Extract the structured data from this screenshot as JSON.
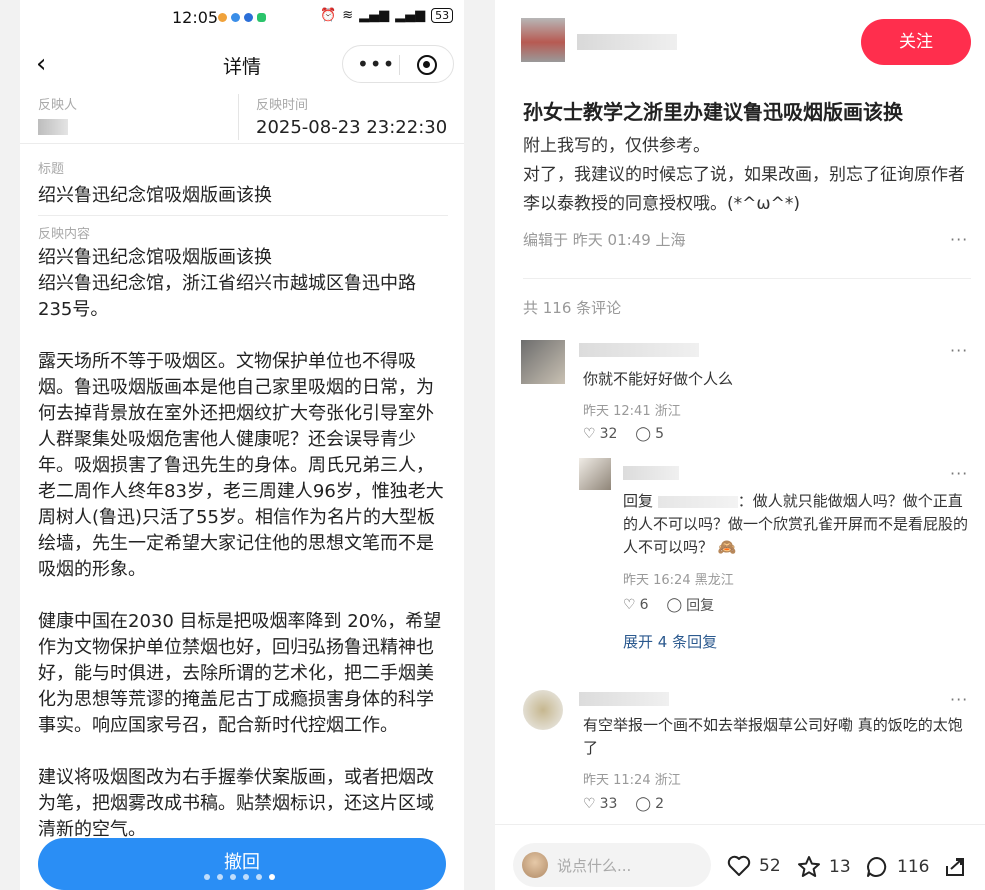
{
  "left": {
    "status": {
      "time": "12:05",
      "battery": "53"
    },
    "nav": {
      "title": "详情"
    },
    "reporter_label": "反映人",
    "report_time_label": "反映时间",
    "report_time": "2025-08-23 23:22:30",
    "title_label": "标题",
    "title_value": "绍兴鲁迅纪念馆吸烟版画该换",
    "content_label": "反映内容",
    "content_head": "绍兴鲁迅纪念馆吸烟版画该换",
    "content_address": "绍兴鲁迅纪念馆，浙江省绍兴市越城区鲁迅中路235号。",
    "para1": "露天场所不等于吸烟区。文物保护单位也不得吸烟。鲁迅吸烟版画本是他自己家里吸烟的日常，为何去掉背景放在室外还把烟纹扩大夸张化引导室外人群聚集处吸烟危害他人健康呢？还会误导青少年。吸烟损害了鲁迅先生的身体。周氏兄弟三人，老二周作人终年83岁，老三周建人96岁，惟独老大周树人(鲁迅)只活了55岁。相信作为名片的大型板绘墙，先生一定希望大家记住他的思想文笔而不是吸烟的形象。",
    "para2": "健康中国在2030 目标是把吸烟率降到 20%，希望作为文物保护单位禁烟也好，回归弘扬鲁迅精神也好，能与时俱进，去除所谓的艺术化，把二手烟美化为思想等荒谬的掩盖尼古丁成瘾损害身体的科学事实。响应国家号召，配合新时代控烟工作。",
    "para3": "建议将吸烟图改为右手握拳伏案版画，或者把烟改为笔，把烟雾改成书稿。贴禁烟标识，还这片区域清新的空气。",
    "withdraw_label": "撤回"
  },
  "right": {
    "follow_label": "关注",
    "post_title": "孙女士教学之浙里办建议鲁迅吸烟版画该换",
    "post_line1": "附上我写的，仅供参考。",
    "post_line2": "对了，我建议的时候忘了说，如果改画，别忘了征询原作者李以泰教授的同意授权哦。(*^ω^*)",
    "post_meta": "编辑于 昨天 01:49 上海",
    "more_glyph": "···",
    "comment_count": "共 116 条评论",
    "comments": [
      {
        "text": "你就不能好好做个人么",
        "meta": "昨天 12:41 浙江",
        "likes": "32",
        "replies": "5"
      },
      {
        "reply_prefix": "回复",
        "text": "：做人就只能做烟人吗？做个正直的人不可以吗？做一个欣赏孔雀开屏而不是看屁股的人不可以吗？",
        "emoji": "🙈",
        "meta": "昨天 16:24 黑龙江",
        "likes": "6",
        "replies": "回复"
      },
      {
        "text": "有空举报一个画不如去举报烟草公司好嘞 真的饭吃的太饱了",
        "meta": "昨天 11:24 浙江",
        "likes": "33",
        "replies": "2"
      }
    ],
    "expand_label": "展开 4 条回复",
    "input_placeholder": "说点什么...",
    "stats": {
      "likes": "52",
      "stars": "13",
      "comments": "116"
    }
  }
}
